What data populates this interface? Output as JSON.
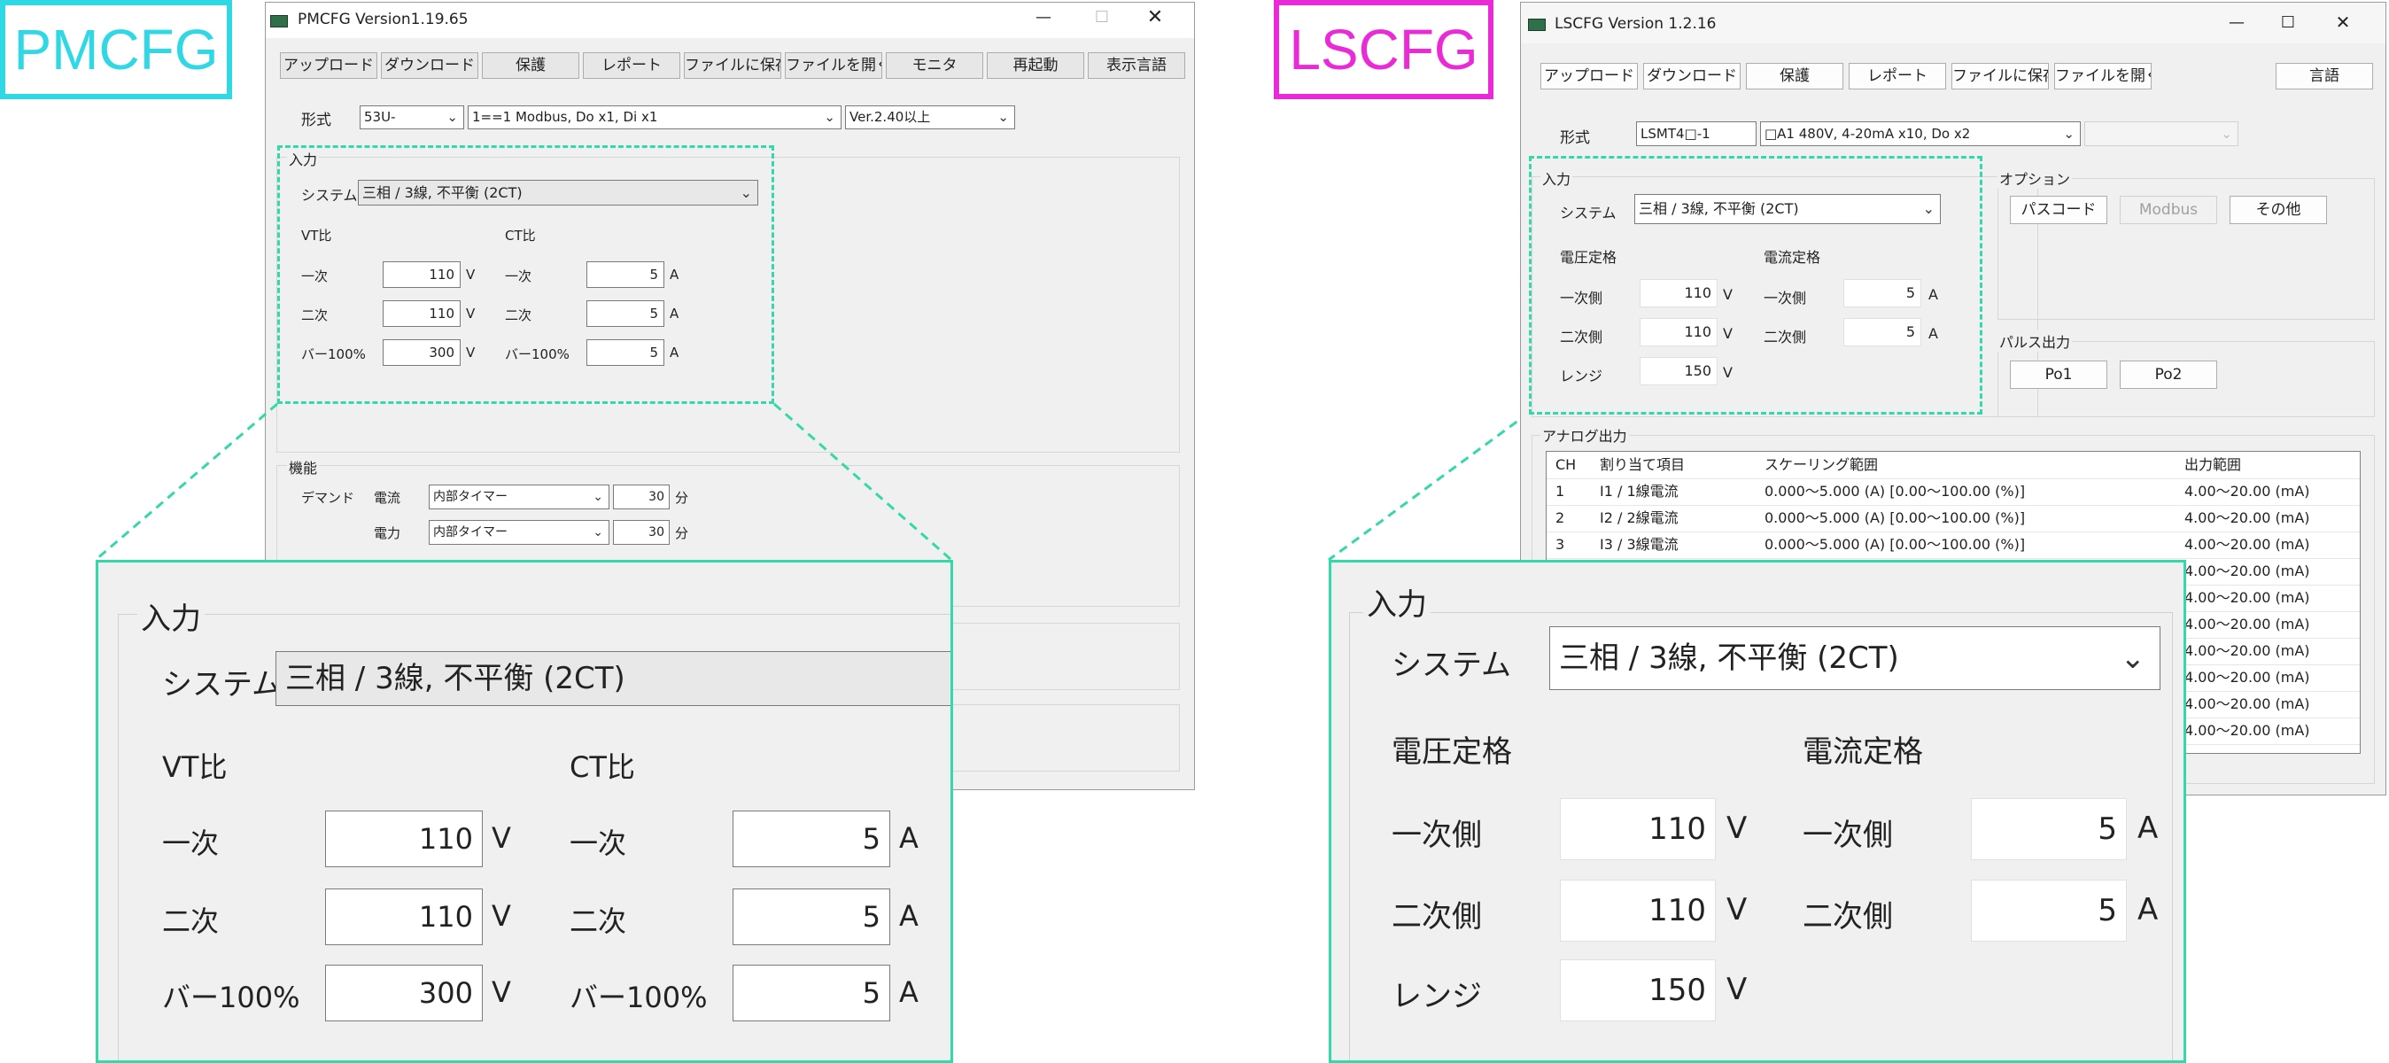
{
  "pm": {
    "tag": "PMCFG",
    "title": "PMCFG Version1.19.65",
    "window_controls": [
      "—",
      "☐",
      "✕"
    ],
    "toolbar": [
      "アップロード",
      "ダウンロード",
      "保護",
      "レポート",
      "ファイルに保存",
      "ファイルを開く",
      "モニタ",
      "再起動",
      "表示言語"
    ],
    "format_label": "形式",
    "format_model": "53U-",
    "format_desc": "1==1 Modbus, Do x1, Di x1",
    "format_ver": "Ver.2.40以上",
    "input_group": "入力",
    "system_label": "システム",
    "system_value": "三相 / 3線, 不平衡 (2CT)",
    "vt_title": "VT比",
    "ct_title": "CT比",
    "vt_rows": [
      {
        "label": "一次",
        "value": "110",
        "unit": "V"
      },
      {
        "label": "二次",
        "value": "110",
        "unit": "V"
      },
      {
        "label": "バー100%",
        "value": "300",
        "unit": "V"
      }
    ],
    "ct_rows": [
      {
        "label": "一次",
        "value": "5",
        "unit": "A"
      },
      {
        "label": "二次",
        "value": "5",
        "unit": "A"
      },
      {
        "label": "バー100%",
        "value": "5",
        "unit": "A"
      }
    ],
    "func_group": "機能",
    "demand_label": "デマンド",
    "demand_rows": [
      {
        "label": "電流",
        "mode": "内部タイマー",
        "value": "30",
        "unit": "分"
      },
      {
        "label": "電力",
        "mode": "内部タイマー",
        "value": "30",
        "unit": "分"
      }
    ]
  },
  "ls": {
    "tag": "LSCFG",
    "title": "LSCFG Version 1.2.16",
    "window_controls": [
      "—",
      "☐",
      "✕"
    ],
    "toolbar": [
      "アップロード",
      "ダウンロード",
      "保護",
      "レポート",
      "ファイルに保存",
      "ファイルを開く"
    ],
    "lang_button": "言語",
    "format_label": "形式",
    "format_model": "LSMT4□-1",
    "format_desc": "□A1 480V, 4-20mA x10, Do x2",
    "input_group": "入力",
    "system_label": "システム",
    "system_value": "三相 / 3線, 不平衡 (2CT)",
    "volt_title": "電圧定格",
    "curr_title": "電流定格",
    "volt_rows": [
      {
        "label": "一次側",
        "value": "110",
        "unit": "V"
      },
      {
        "label": "二次側",
        "value": "110",
        "unit": "V"
      },
      {
        "label": "レンジ",
        "value": "150",
        "unit": "V"
      }
    ],
    "curr_rows": [
      {
        "label": "一次側",
        "value": "5",
        "unit": "A"
      },
      {
        "label": "二次側",
        "value": "5",
        "unit": "A"
      }
    ],
    "option_group": "オプション",
    "option_buttons": [
      "パスコード",
      "Modbus",
      "その他"
    ],
    "pulse_group": "パルス出力",
    "pulse_buttons": [
      "Po1",
      "Po2"
    ],
    "analog_group": "アナログ出力",
    "table_headers": [
      "CH",
      "割り当て項目",
      "スケーリング範囲",
      "出力範囲"
    ],
    "table_rows": [
      [
        "1",
        "I1 / 1線電流",
        "0.000～5.000 (A) [0.00～100.00 (%)]",
        "4.00～20.00 (mA)"
      ],
      [
        "2",
        "I2 / 2線電流",
        "0.000～5.000 (A) [0.00～100.00 (%)]",
        "4.00～20.00 (mA)"
      ],
      [
        "3",
        "I3 / 3線電流",
        "0.000～5.000 (A) [0.00～100.00 (%)]",
        "4.00～20.00 (mA)"
      ]
    ],
    "extra_output_range": "4.00～20.00 (mA)"
  },
  "colors": {
    "pm_tag": "#2fd8e4",
    "ls_tag": "#ea2ad6",
    "zoom_border": "#35d8a8",
    "pm_tag_text": "#2fd8e4",
    "ls_tag_text": "#ea2ad6"
  }
}
